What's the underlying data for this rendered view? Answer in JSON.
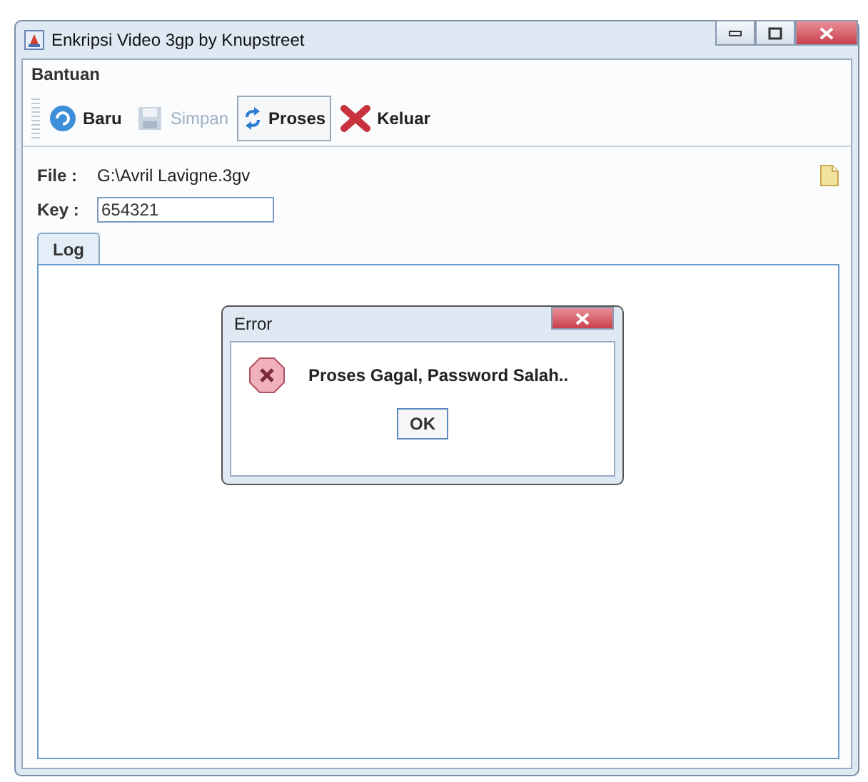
{
  "window": {
    "title": "Enkripsi Video 3gp by Knupstreet"
  },
  "menu": [
    "Bantuan"
  ],
  "toolbar": [
    {
      "label": "Baru",
      "disabled": false,
      "selected": false
    },
    {
      "label": "Simpan",
      "disabled": true,
      "selected": false
    },
    {
      "label": "Proses",
      "disabled": false,
      "selected": true
    },
    {
      "label": "Keluar",
      "disabled": false,
      "selected": false
    }
  ],
  "file": {
    "label": "File :",
    "value": "G:\\Avril Lavigne.3gv"
  },
  "key": {
    "label": "Key :",
    "value": "654321"
  },
  "tabs": [
    {
      "label": "Log",
      "selected": true
    }
  ],
  "dialog": {
    "title": "Error",
    "message": "Proses Gagal, Password Salah..",
    "button": "OK"
  }
}
